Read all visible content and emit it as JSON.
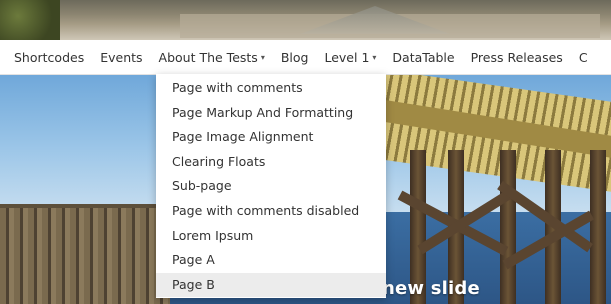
{
  "navbar": {
    "items": [
      {
        "label": "Shortcodes",
        "has_caret": false
      },
      {
        "label": "Events",
        "has_caret": false
      },
      {
        "label": "About The Tests",
        "has_caret": true
      },
      {
        "label": "Blog",
        "has_caret": false
      },
      {
        "label": "Level 1",
        "has_caret": true
      },
      {
        "label": "DataTable",
        "has_caret": false
      },
      {
        "label": "Press Releases",
        "has_caret": false
      },
      {
        "label": "C",
        "has_caret": false
      }
    ]
  },
  "dropdown": {
    "parent": "About The Tests",
    "items": [
      "Page with comments",
      "Page Markup And Formatting",
      "Page Image Alignment",
      "Clearing Floats",
      "Sub-page",
      "Page with comments disabled",
      "Lorem Ipsum",
      "Page A",
      "Page B"
    ],
    "hovered": "Page B"
  },
  "slider": {
    "caption": "new slide"
  },
  "icons": {
    "caret": "caret-down-icon"
  }
}
